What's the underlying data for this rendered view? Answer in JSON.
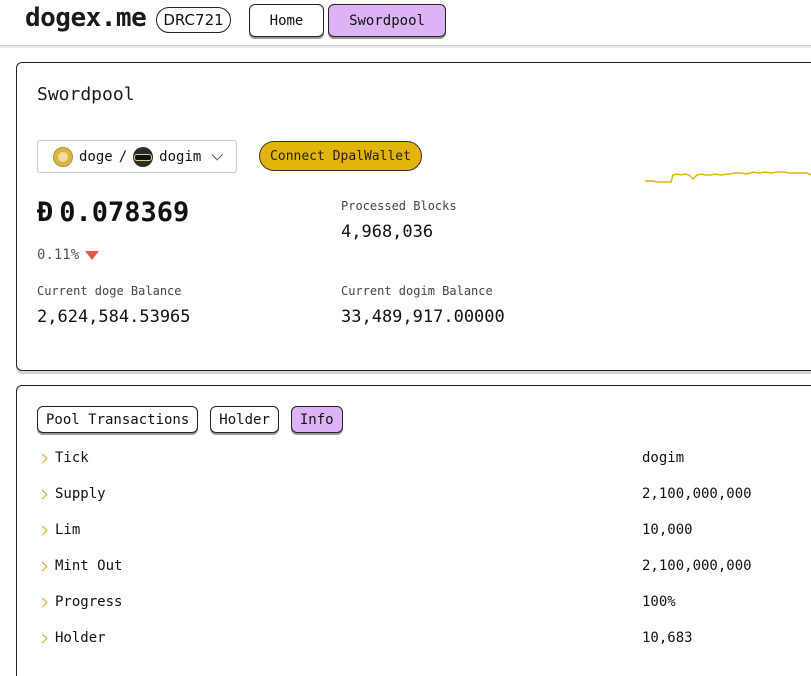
{
  "header": {
    "logo": "dogex.me",
    "badge": "DRC721",
    "nav": [
      {
        "label": "Home",
        "active": false
      },
      {
        "label": "Swordpool",
        "active": true
      }
    ]
  },
  "pool": {
    "title": "Swordpool",
    "pair": {
      "base": "doge",
      "separator": "/",
      "quote": "dogim"
    },
    "connect_label": "Connect DpalWallet",
    "price_symbol": "Đ",
    "price": "0.078369",
    "change": "0.11%",
    "change_direction": "down",
    "stats": {
      "processed_blocks_label": "Processed Blocks",
      "processed_blocks": "4,968,036",
      "doge_balance_label": "Current doge Balance",
      "doge_balance": "2,624,584.53965",
      "dogim_balance_label": "Current dogim Balance",
      "dogim_balance": "33,489,917.00000"
    },
    "sparkline_color": "#e3b509"
  },
  "details": {
    "tabs": [
      {
        "label": "Pool Transactions",
        "active": false
      },
      {
        "label": "Holder",
        "active": false
      },
      {
        "label": "Info",
        "active": true
      }
    ],
    "info": [
      {
        "label": "Tick",
        "value": "dogim"
      },
      {
        "label": "Supply",
        "value": "2,100,000,000"
      },
      {
        "label": "Lim",
        "value": "10,000"
      },
      {
        "label": "Mint Out",
        "value": "2,100,000,000"
      },
      {
        "label": "Progress",
        "value": "100%"
      },
      {
        "label": "Holder",
        "value": "10,683"
      }
    ]
  },
  "colors": {
    "accent_purple": "#dcb4f6",
    "accent_gold": "#e3b509",
    "down_red": "#e35b4d"
  }
}
